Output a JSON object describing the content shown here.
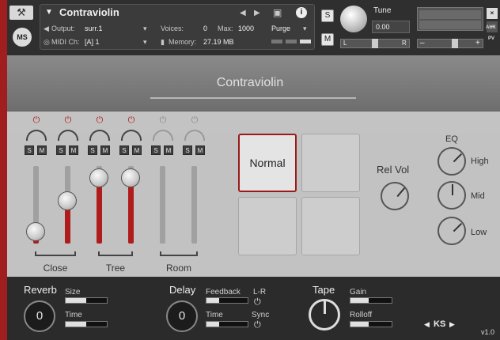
{
  "header": {
    "instrument_name": "Contraviolin",
    "output_label": "Output:",
    "output_value": "surr.1",
    "voices_label": "Voices:",
    "voices_value": "0",
    "max_label": "Max:",
    "max_value": "1000",
    "midi_label": "MIDI Ch:",
    "midi_value": "[A]  1",
    "memory_label": "Memory:",
    "memory_value": "27.19 MB",
    "purge_label": "Purge",
    "s_label": "S",
    "m_label": "M",
    "tune_label": "Tune",
    "tune_value": "0.00",
    "pan_left": "L",
    "pan_right": "R",
    "aux_label": "AUX",
    "pv_label": "PV",
    "ms_logo": "MS"
  },
  "title": "Contraviolin",
  "mixer": {
    "solo": "S",
    "mute": "M",
    "groups": [
      "Close",
      "Tree",
      "Room"
    ],
    "channels": [
      {
        "enabled": true,
        "level": 0.15
      },
      {
        "enabled": true,
        "level": 0.55
      },
      {
        "enabled": true,
        "level": 0.85
      },
      {
        "enabled": true,
        "level": 0.85
      },
      {
        "enabled": false,
        "level": 0.0
      },
      {
        "enabled": false,
        "level": 0.0
      }
    ]
  },
  "pads": {
    "selected_label": "Normal"
  },
  "rel_vol": {
    "label": "Rel Vol"
  },
  "eq": {
    "label": "EQ",
    "high": "High",
    "mid": "Mid",
    "low": "Low"
  },
  "bottom": {
    "reverb_label": "Reverb",
    "reverb_value": "0",
    "size_label": "Size",
    "size_level": 0.5,
    "time_label": "Time",
    "reverb_time_level": 0.5,
    "delay_label": "Delay",
    "delay_value": "0",
    "feedback_label": "Feedback",
    "feedback_level": 0.3,
    "delay_time_label": "Time",
    "delay_time_level": 0.3,
    "lr_label": "L-R",
    "sync_label": "Sync",
    "tape_label": "Tape",
    "gain_label": "Gain",
    "gain_level": 0.45,
    "rolloff_label": "Rolloff",
    "rolloff_level": 0.45,
    "ks_label": "KS",
    "version": "v1.0"
  }
}
